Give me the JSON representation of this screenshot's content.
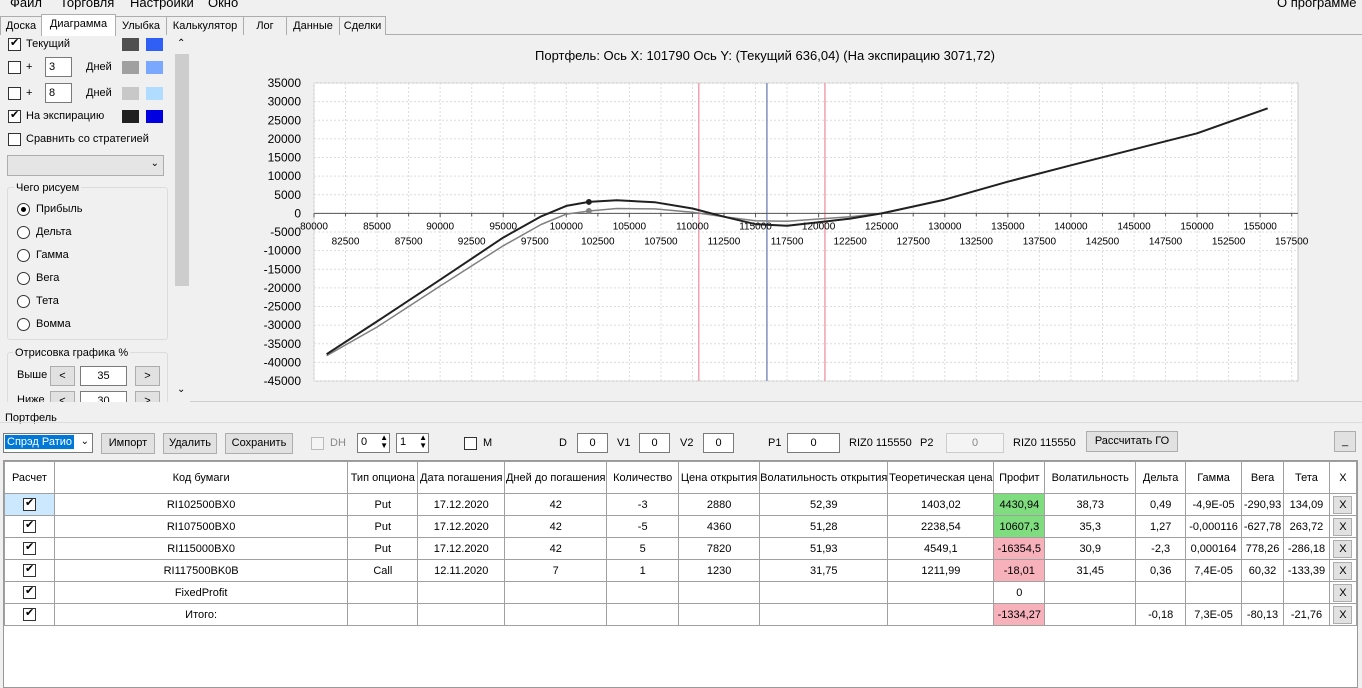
{
  "menu": {
    "file": "Файл",
    "trade": "Торговля",
    "settings": "Настройки",
    "window": "Окно",
    "about": "О программе"
  },
  "tabs": [
    "Доска",
    "Диаграмма",
    "Улыбка",
    "Калькулятор",
    "Лог",
    "Данные",
    "Сделки"
  ],
  "left": {
    "current_label": "Текущий",
    "plus_label": "+",
    "days1": "3",
    "days2": "8",
    "days_label": "Дней",
    "expiry_label": "На экспирацию",
    "compare_label": "Сравнить со стратегией",
    "draw_group": "Чего рисуем",
    "radios": [
      "Прибыль",
      "Дельта",
      "Гамма",
      "Вега",
      "Тета",
      "Вомма"
    ],
    "render_group": "Отрисовка графика %",
    "above_label": "Выше",
    "above_value": "35",
    "below_label": "Ниже",
    "below_value": "30",
    "prev": "<",
    "next": ">",
    "colors": {
      "current_dark": "#505050",
      "current_light": "#2f5ff5",
      "d3_dark": "#a0a0a0",
      "d3_light": "#7aa7ff",
      "d8_dark": "#c8c8c8",
      "d8_light": "#b0dcff",
      "exp_dark": "#202020",
      "exp_light": "#0000e0"
    }
  },
  "chart_title": "Портфель: Ось X: 101790 Ось Y:  (Текущий 636,04)  (На экспирацию 3071,72)",
  "chart_data": {
    "type": "line",
    "x_ticks_top": [
      80000,
      85000,
      90000,
      95000,
      100000,
      105000,
      110000,
      115000,
      120000,
      125000,
      130000,
      135000,
      140000,
      145000,
      150000,
      155000
    ],
    "x_ticks_bottom": [
      82500,
      87500,
      92500,
      97500,
      102500,
      107500,
      112500,
      117500,
      122500,
      127500,
      132500,
      137500,
      142500,
      147500,
      152500,
      157500
    ],
    "y_ticks": [
      35000,
      30000,
      25000,
      20000,
      15000,
      10000,
      5000,
      0,
      -5000,
      -10000,
      -15000,
      -20000,
      -25000,
      -30000,
      -35000,
      -40000,
      -45000
    ],
    "xlim": [
      80000,
      158000
    ],
    "ylim": [
      -45000,
      35000
    ],
    "vlines": [
      {
        "x": 110500,
        "color": "#f3a0b0"
      },
      {
        "x": 115900,
        "color": "#8090c0"
      },
      {
        "x": 120500,
        "color": "#f3a0b0"
      }
    ],
    "series": [
      {
        "color": "#202020",
        "points": [
          [
            81000,
            -37800
          ],
          [
            85000,
            -29000
          ],
          [
            90000,
            -17800
          ],
          [
            95000,
            -6500
          ],
          [
            98000,
            -800
          ],
          [
            100000,
            2000
          ],
          [
            101790,
            3070
          ],
          [
            104000,
            3500
          ],
          [
            107000,
            3000
          ],
          [
            110000,
            1300
          ],
          [
            112500,
            -900
          ],
          [
            115000,
            -2900
          ],
          [
            117500,
            -3300
          ],
          [
            120000,
            -2400
          ],
          [
            122500,
            -1400
          ],
          [
            125000,
            0
          ],
          [
            130000,
            3700
          ],
          [
            135000,
            8500
          ],
          [
            140000,
            12900
          ],
          [
            145000,
            17200
          ],
          [
            150000,
            21500
          ],
          [
            155600,
            28200
          ]
        ]
      },
      {
        "color": "#808080",
        "points": [
          [
            81000,
            -38200
          ],
          [
            85000,
            -30500
          ],
          [
            90000,
            -19500
          ],
          [
            95000,
            -8700
          ],
          [
            98000,
            -3000
          ],
          [
            100000,
            -200
          ],
          [
            101790,
            640
          ],
          [
            104000,
            1300
          ],
          [
            107000,
            1200
          ],
          [
            110000,
            300
          ],
          [
            112500,
            -900
          ],
          [
            115000,
            -2000
          ],
          [
            117500,
            -2100
          ],
          [
            120000,
            -1500
          ],
          [
            122500,
            -900
          ],
          [
            125000,
            0
          ]
        ]
      }
    ],
    "markers": [
      {
        "x": 101790,
        "y": 3070,
        "color": "#202020"
      },
      {
        "x": 101790,
        "y": 640,
        "color": "#808080"
      }
    ]
  },
  "portfolio": {
    "label": "Портфель",
    "strategy": "Спрэд Ратио",
    "import": "Импорт",
    "delete": "Удалить",
    "save": "Сохранить",
    "dh": "DH",
    "dh_a": "0",
    "dh_b": "1",
    "m": "M",
    "d_label": "D",
    "d_val": "0",
    "v1_label": "V1",
    "v1_val": "0",
    "v2_label": "V2",
    "v2_val": "0",
    "p1_label": "P1",
    "p1_val": "0",
    "riz1": "RIZ0 115550",
    "p2_label": "P2",
    "p2_val": "0",
    "riz2": "RIZ0 115550",
    "calc_go": "Рассчитать ГО",
    "min": "_"
  },
  "table": {
    "headers": [
      "Расчет",
      "Код бумаги",
      "Тип опциона",
      "Дата погашения",
      "Дней до погашения",
      "Количество",
      "Цена открытия",
      "Волатильность открытия",
      "Теоретическая цена",
      "Профит",
      "Волатильность",
      "Дельта",
      "Гамма",
      "Вега",
      "Тета",
      "X"
    ],
    "rows": [
      {
        "code": "RI102500BX0",
        "type": "Put",
        "date": "17.12.2020",
        "days": "42",
        "qty": "-3",
        "price": "2880",
        "vol_open": "52,39",
        "theo": "1403,02",
        "profit": "4430,94",
        "profit_sign": "pos",
        "vol": "38,73",
        "delta": "0,49",
        "gamma": "-4,9E-05",
        "vega": "-290,93",
        "theta": "134,09"
      },
      {
        "code": "RI107500BX0",
        "type": "Put",
        "date": "17.12.2020",
        "days": "42",
        "qty": "-5",
        "price": "4360",
        "vol_open": "51,28",
        "theo": "2238,54",
        "profit": "10607,3",
        "profit_sign": "pos",
        "vol": "35,3",
        "delta": "1,27",
        "gamma": "-0,000116",
        "vega": "-627,78",
        "theta": "263,72"
      },
      {
        "code": "RI115000BX0",
        "type": "Put",
        "date": "17.12.2020",
        "days": "42",
        "qty": "5",
        "price": "7820",
        "vol_open": "51,93",
        "theo": "4549,1",
        "profit": "-16354,5",
        "profit_sign": "neg",
        "vol": "30,9",
        "delta": "-2,3",
        "gamma": "0,000164",
        "vega": "778,26",
        "theta": "-286,18"
      },
      {
        "code": "RI117500BK0B",
        "type": "Call",
        "date": "12.11.2020",
        "days": "7",
        "qty": "1",
        "price": "1230",
        "vol_open": "31,75",
        "theo": "1211,99",
        "profit": "-18,01",
        "profit_sign": "neg",
        "vol": "31,45",
        "delta": "0,36",
        "gamma": "7,4E-05",
        "vega": "60,32",
        "theta": "-133,39"
      },
      {
        "code": "FixedProfit",
        "type": "",
        "date": "",
        "days": "",
        "qty": "",
        "price": "",
        "vol_open": "",
        "theo": "",
        "profit": "0",
        "profit_sign": "none",
        "vol": "",
        "delta": "",
        "gamma": "",
        "vega": "",
        "theta": ""
      },
      {
        "code": "Итого:",
        "type": "",
        "date": "",
        "days": "",
        "qty": "",
        "price": "",
        "vol_open": "",
        "theo": "",
        "profit": "-1334,27",
        "profit_sign": "neg",
        "vol": "",
        "delta": "-0,18",
        "gamma": "7,3E-05",
        "vega": "-80,13",
        "theta": "-21,76"
      }
    ]
  }
}
